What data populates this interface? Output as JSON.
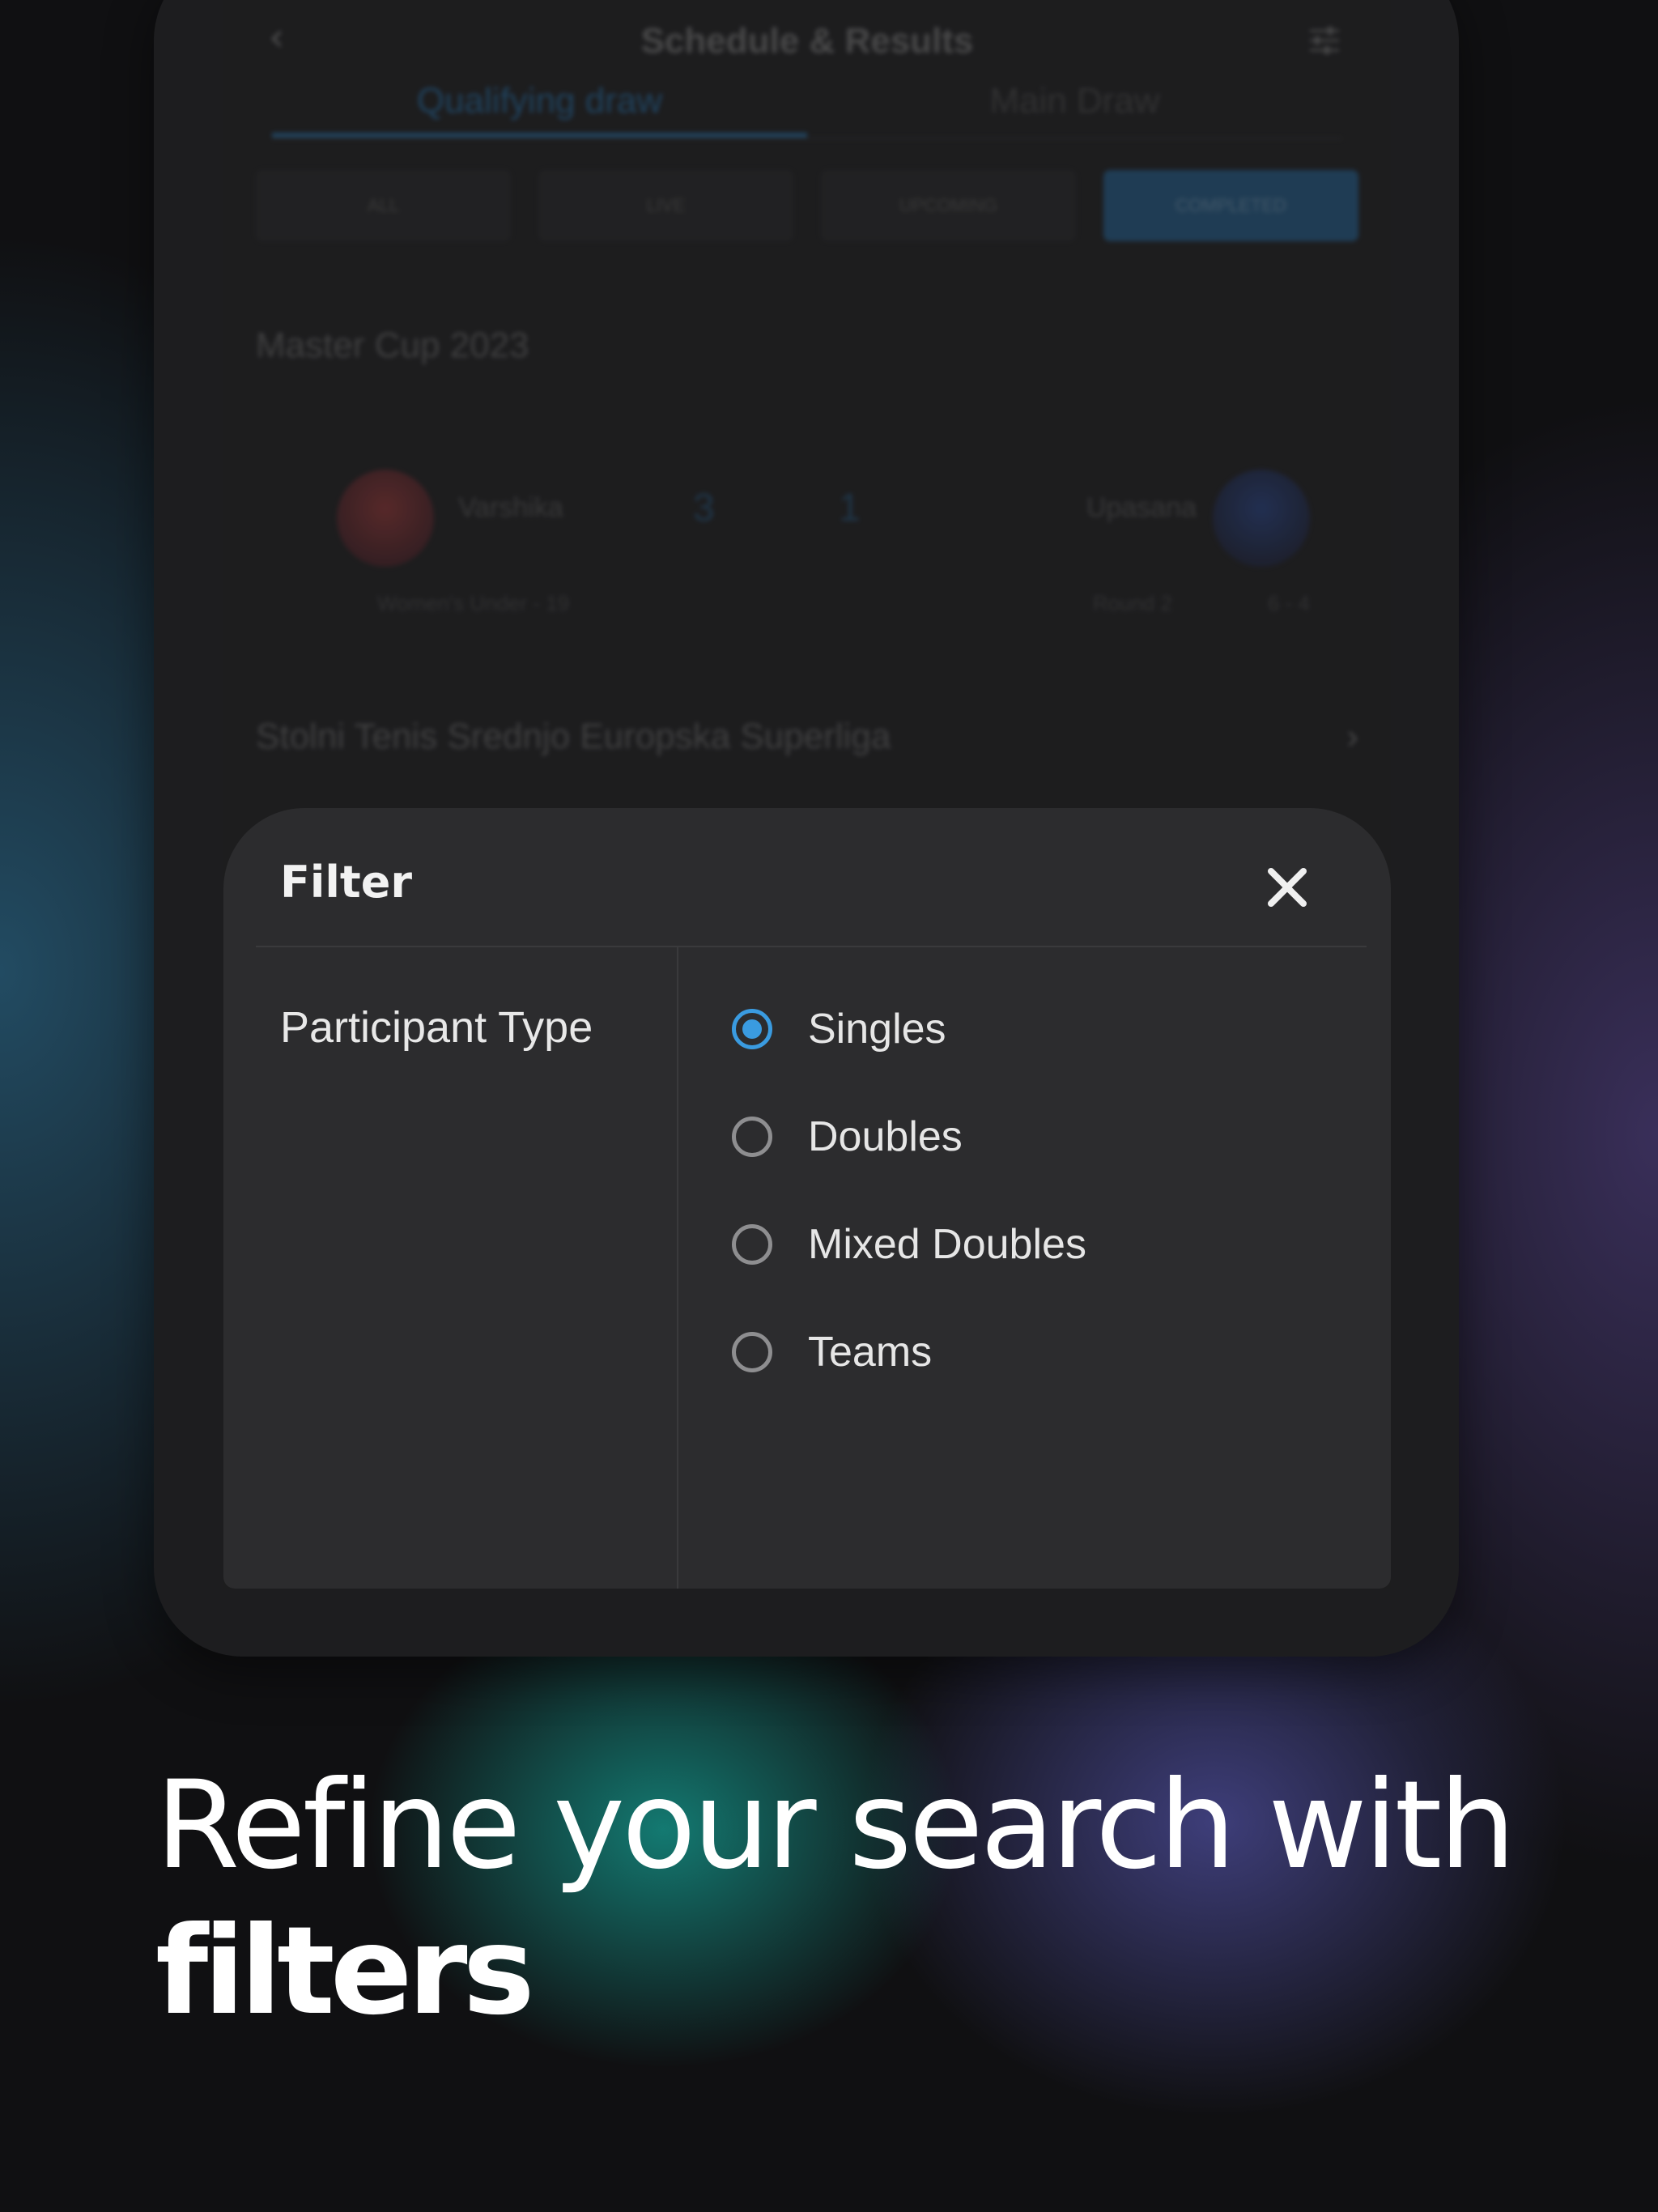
{
  "app": {
    "title": "Schedule & Results",
    "tabs": [
      {
        "label": "Qualifying draw",
        "active": true
      },
      {
        "label": "Main Draw",
        "active": false
      }
    ],
    "chips": [
      {
        "label": "ALL",
        "active": false
      },
      {
        "label": "LIVE",
        "active": false
      },
      {
        "label": "UPCOMING",
        "active": false
      },
      {
        "label": "COMPLETED",
        "active": true
      }
    ],
    "section_title": "Master Cup 2023",
    "match": {
      "player_left": "Varshika",
      "score_left": "3",
      "score_right": "1",
      "player_right": "Upasana",
      "category": "Women's Under - 19",
      "round": "Round 2",
      "set_score": "6 - 4"
    },
    "league_title": "Stolni Tenis Srednjo Europska Superliga"
  },
  "filter": {
    "title": "Filter",
    "category": "Participant Type",
    "options": [
      {
        "label": "Singles",
        "selected": true
      },
      {
        "label": "Doubles",
        "selected": false
      },
      {
        "label": "Mixed Doubles",
        "selected": false
      },
      {
        "label": "Teams",
        "selected": false
      }
    ]
  },
  "headline": {
    "line1": "Refine your search with",
    "line2": "filters"
  },
  "colors": {
    "accent": "#3a9be0",
    "sheet_bg": "#2c2c2e",
    "text_primary": "#e6e6e6"
  },
  "icons": {
    "back": "chevron-left-icon",
    "filter": "sliders-icon",
    "close": "close-icon",
    "league_arrow": "chevron-right-icon"
  }
}
